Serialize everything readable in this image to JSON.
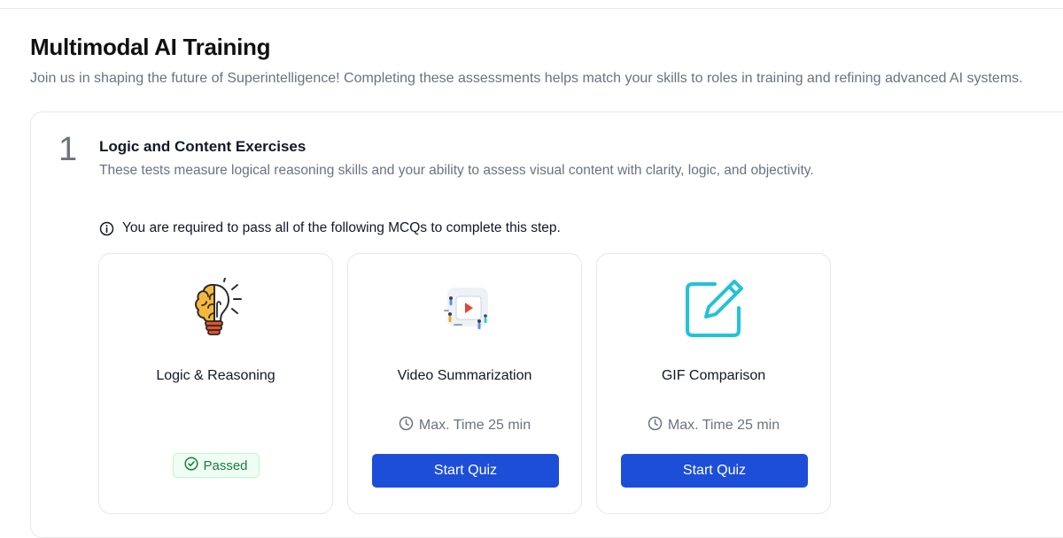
{
  "header": {
    "title": "Multimodal AI Training",
    "subtitle": "Join us in shaping the future of Superintelligence! Completing these assessments helps match your skills to roles in training and refining advanced AI systems."
  },
  "step": {
    "number": "1",
    "title": "Logic and Content Exercises",
    "description": "These tests measure logical reasoning skills and your ability to assess visual content with clarity, logic, and objectivity.",
    "notice": "You are required to pass all of the following MCQs to complete this step."
  },
  "quizzes": [
    {
      "name": "Logic & Reasoning",
      "icon": "brain-lightbulb-icon",
      "status": "Passed"
    },
    {
      "name": "Video Summarization",
      "icon": "video-presentation-icon",
      "time": "Max. Time 25 min",
      "button": "Start Quiz"
    },
    {
      "name": "GIF Comparison",
      "icon": "edit-pencil-icon",
      "time": "Max. Time 25 min",
      "button": "Start Quiz"
    }
  ],
  "colors": {
    "primary_button": "#1d4ed8",
    "passed_text": "#15803d",
    "passed_bg": "#f0fdf4",
    "edit_icon": "#22c3d8",
    "muted_text": "#6b7280"
  }
}
